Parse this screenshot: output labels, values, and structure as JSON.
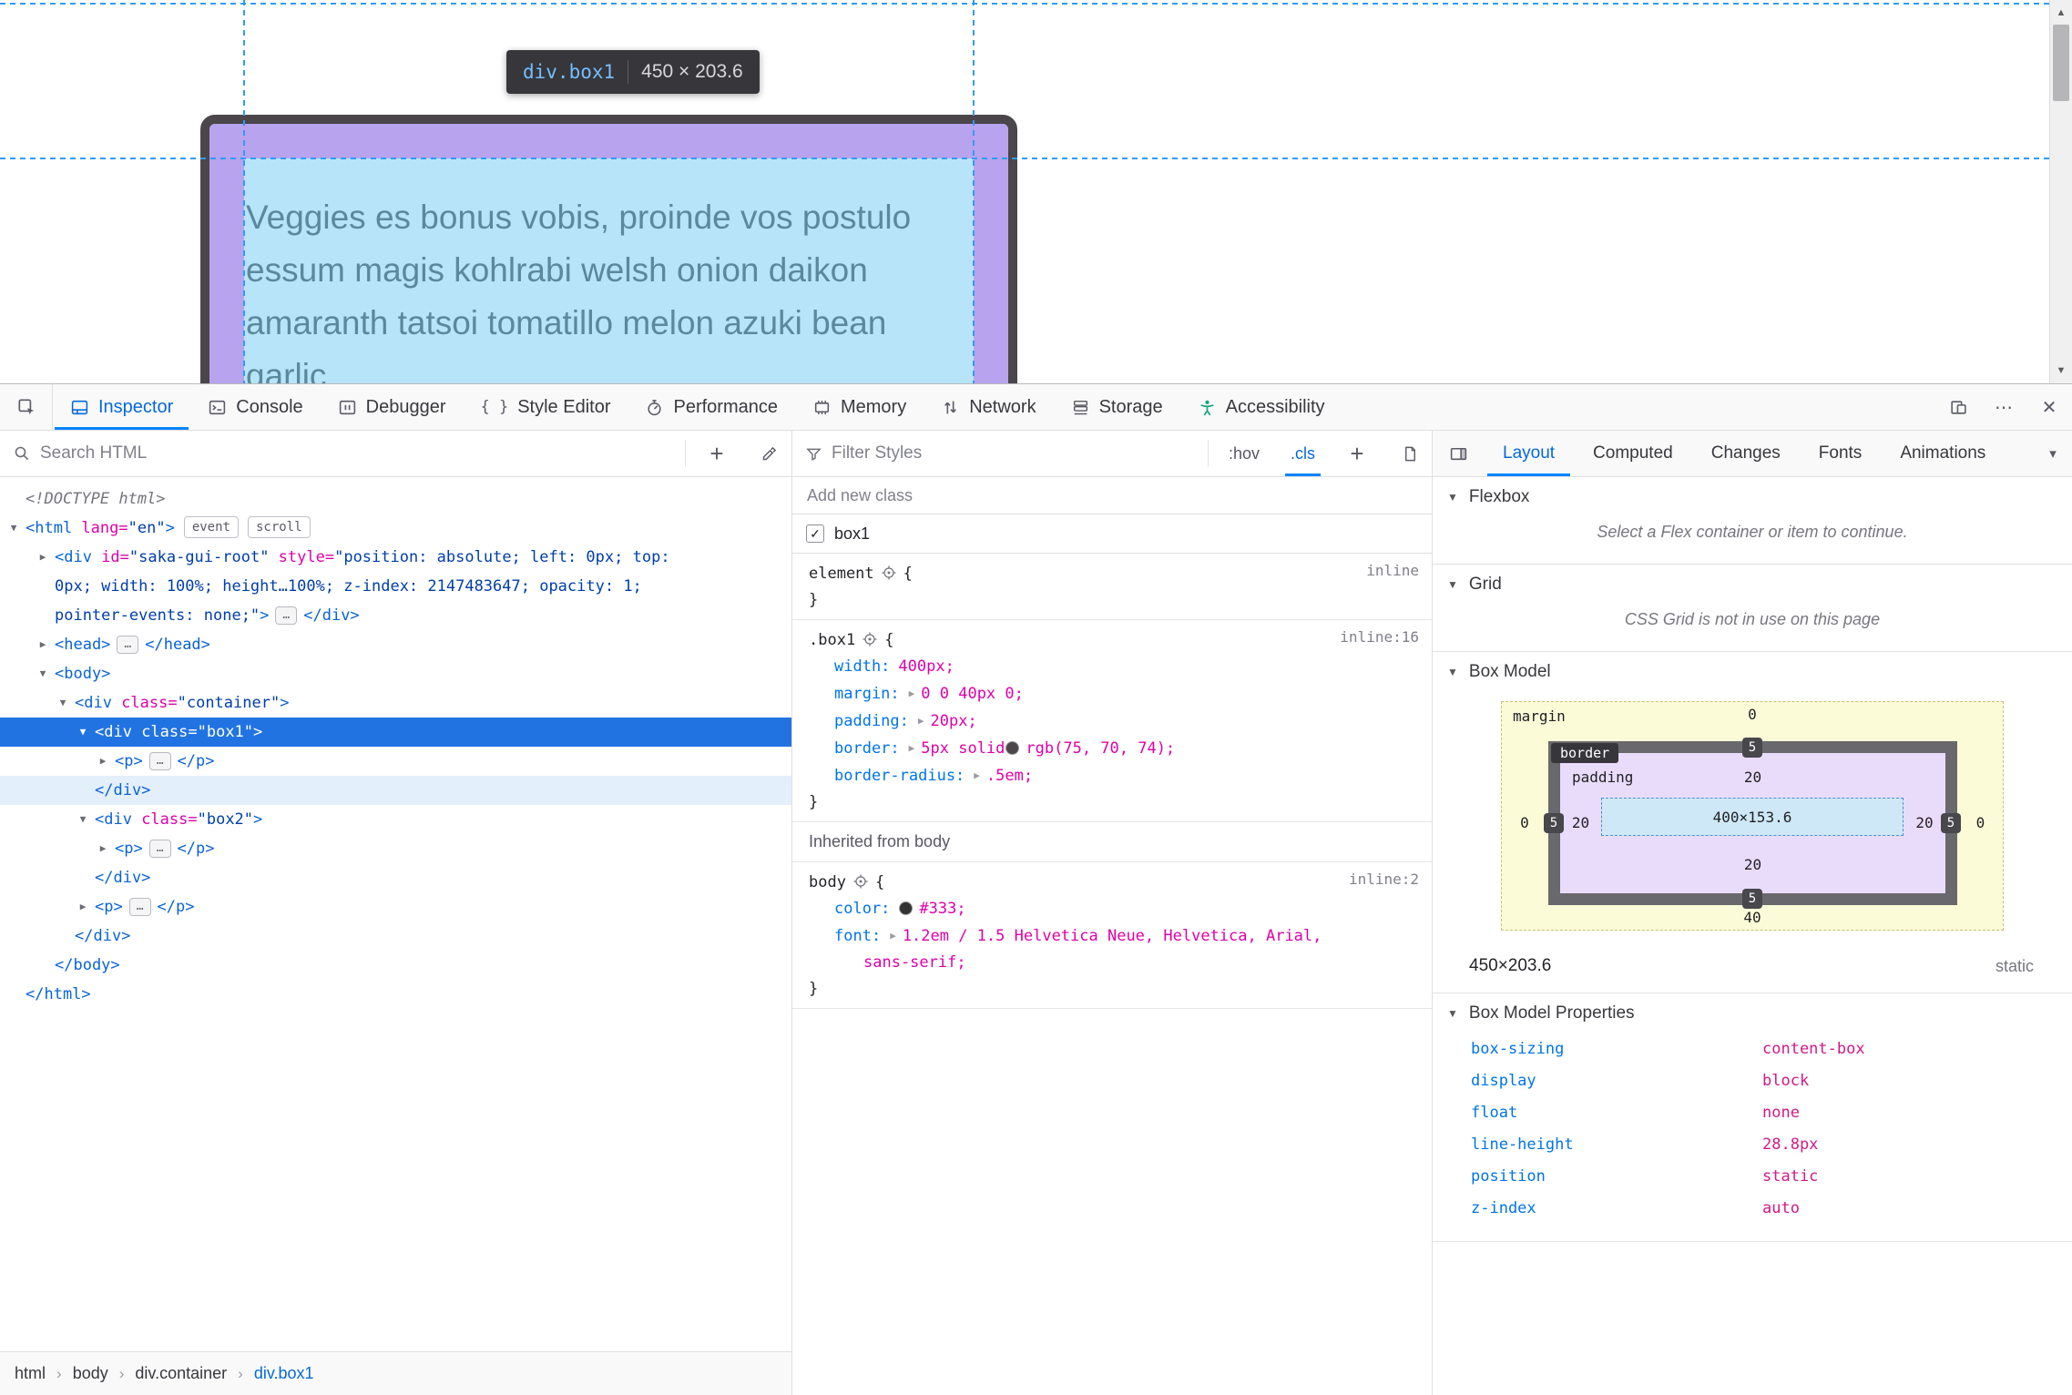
{
  "colors": {
    "accent_blue": "#0a84ff",
    "selection_blue": "#2273e2",
    "guide_blue": "#2f9bf8",
    "padding_highlight": "#9677e6",
    "content_highlight": "#7dcdf4",
    "inspected_border": "#4b464a",
    "accessibility_icon": "#12a579"
  },
  "page": {
    "tooltip": {
      "selector": "div.box1",
      "dimensions": "450 × 203.6"
    },
    "content_lines": [
      "Veggies es bonus vobis, proinde vos postulo",
      "essum magis kohlrabi welsh onion daikon",
      "amaranth tatsoi tomatillo melon azuki bean",
      "garlic."
    ]
  },
  "icons": {
    "twisty_open": "▼",
    "twisty_closed": "▶",
    "ellipsis": "…",
    "plus": "+",
    "meatballs": "⋯",
    "close": "✕",
    "dropdown": "▾",
    "breadcrumb_sep": "›",
    "check": "✓",
    "braces": "{ }",
    "arrow_up": "▲",
    "arrow_down": "▼"
  },
  "toolbox": {
    "tabs": [
      "Inspector",
      "Console",
      "Debugger",
      "Style Editor",
      "Performance",
      "Memory",
      "Network",
      "Storage",
      "Accessibility"
    ]
  },
  "markup": {
    "search_placeholder": "Search HTML",
    "doctype": "<!DOCTYPE html>",
    "html_open": {
      "tag": "<html",
      "attr": " lang=",
      "value": "\"en\"",
      "close": ">"
    },
    "badges": [
      "event",
      "scroll"
    ],
    "saka": {
      "l1_tag": "<div",
      "l1_attr1": " id=",
      "l1_val1": "\"saka-gui-root\"",
      "l1_attr2": " style=",
      "l1_val2": "\"position: absolute; left: 0px; top:",
      "l2": "0px; width: 100%; height…100%; z-index: 2147483647; opacity: 1;",
      "l3_val": "pointer-events: none;\"",
      "l3_close": ">",
      "l3_end": "</div>"
    },
    "head": {
      "open": "<head>",
      "close": "</head>"
    },
    "body_open": "<body>",
    "container": {
      "tag": "<div",
      "attr": " class=",
      "value": "\"container\"",
      "close": ">"
    },
    "box1": {
      "tag": "<div",
      "attr": " class=",
      "value": "\"box1\"",
      "close": ">"
    },
    "box2": {
      "tag": "<div",
      "attr": " class=",
      "value": "\"box2\"",
      "close": ">"
    },
    "p_open": "<p>",
    "p_close": "</p>",
    "div_close": "</div>",
    "body_close": "</body>",
    "html_close": "</html>",
    "breadcrumbs": [
      "html",
      "body",
      "div.container",
      "div.box1"
    ]
  },
  "rules": {
    "filter_placeholder": "Filter Styles",
    "hov": ":hov",
    "cls": ".cls",
    "add_class_placeholder": "Add new class",
    "class_toggle": "box1",
    "braces": {
      "open": "{",
      "close": "}"
    },
    "element_rule": {
      "selector": "element",
      "link": "inline"
    },
    "box1_rule": {
      "selector": ".box1",
      "link": "inline:16",
      "width_name": "width:",
      "width_value": "400px;",
      "margin_name": "margin:",
      "margin_value": "0 0 40px 0;",
      "padding_name": "padding:",
      "padding_value": "20px;",
      "border_name": "border:",
      "border_value1": "5px solid",
      "border_swatch": "#4b464a",
      "border_value2": "rgb(75, 70, 74);",
      "radius_name": "border-radius:",
      "radius_value": ".5em;"
    },
    "inherited_header": "Inherited from body",
    "body_rule": {
      "selector": "body",
      "link": "inline:2",
      "color_name": "color:",
      "color_swatch": "#333",
      "color_value": "#333;",
      "font_name": "font:",
      "font_value_l1": "1.2em / 1.5 Helvetica Neue, Helvetica, Arial,",
      "font_value_l2": "sans-serif;"
    }
  },
  "layout": {
    "tabs": [
      "Layout",
      "Computed",
      "Changes",
      "Fonts",
      "Animations"
    ],
    "flexbox": {
      "title": "Flexbox",
      "message": "Select a Flex container or item to continue."
    },
    "grid": {
      "title": "Grid",
      "message": "CSS Grid is not in use on this page"
    },
    "box_model": {
      "title": "Box Model",
      "margin_label": "margin",
      "border_label": "border",
      "padding_label": "padding",
      "margin": {
        "top": "0",
        "right": "0",
        "bottom": "40",
        "left": "0"
      },
      "border": {
        "top": "5",
        "right": "5",
        "bottom": "5",
        "left": "5"
      },
      "padding": {
        "top": "20",
        "right": "20",
        "bottom": "20",
        "left": "20"
      },
      "content": "400×153.6",
      "dimensions": "450×203.6",
      "position": "static"
    },
    "properties": {
      "title": "Box Model Properties",
      "rows": [
        {
          "name": "box-sizing",
          "value": "content-box"
        },
        {
          "name": "display",
          "value": "block"
        },
        {
          "name": "float",
          "value": "none"
        },
        {
          "name": "line-height",
          "value": "28.8px"
        },
        {
          "name": "position",
          "value": "static"
        },
        {
          "name": "z-index",
          "value": "auto"
        }
      ]
    }
  }
}
